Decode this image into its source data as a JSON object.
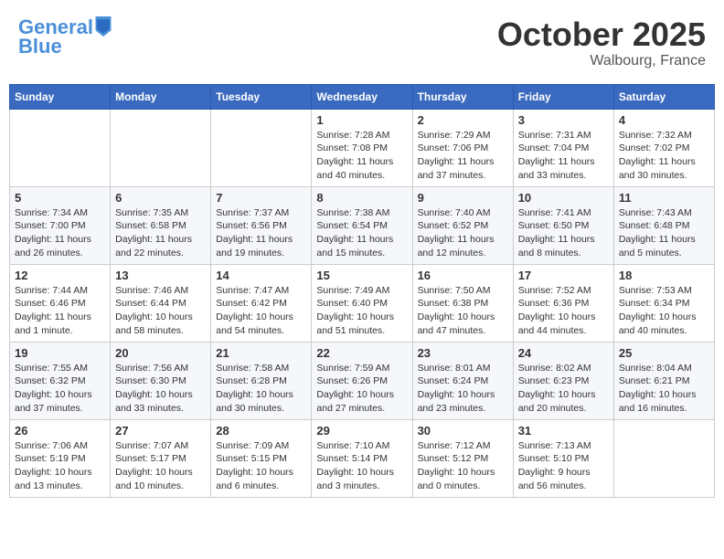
{
  "header": {
    "logo_line1": "General",
    "logo_line2": "Blue",
    "month": "October 2025",
    "location": "Walbourg, France"
  },
  "days_of_week": [
    "Sunday",
    "Monday",
    "Tuesday",
    "Wednesday",
    "Thursday",
    "Friday",
    "Saturday"
  ],
  "weeks": [
    [
      {
        "day": "",
        "info": ""
      },
      {
        "day": "",
        "info": ""
      },
      {
        "day": "",
        "info": ""
      },
      {
        "day": "1",
        "info": "Sunrise: 7:28 AM\nSunset: 7:08 PM\nDaylight: 11 hours and 40 minutes."
      },
      {
        "day": "2",
        "info": "Sunrise: 7:29 AM\nSunset: 7:06 PM\nDaylight: 11 hours and 37 minutes."
      },
      {
        "day": "3",
        "info": "Sunrise: 7:31 AM\nSunset: 7:04 PM\nDaylight: 11 hours and 33 minutes."
      },
      {
        "day": "4",
        "info": "Sunrise: 7:32 AM\nSunset: 7:02 PM\nDaylight: 11 hours and 30 minutes."
      }
    ],
    [
      {
        "day": "5",
        "info": "Sunrise: 7:34 AM\nSunset: 7:00 PM\nDaylight: 11 hours and 26 minutes."
      },
      {
        "day": "6",
        "info": "Sunrise: 7:35 AM\nSunset: 6:58 PM\nDaylight: 11 hours and 22 minutes."
      },
      {
        "day": "7",
        "info": "Sunrise: 7:37 AM\nSunset: 6:56 PM\nDaylight: 11 hours and 19 minutes."
      },
      {
        "day": "8",
        "info": "Sunrise: 7:38 AM\nSunset: 6:54 PM\nDaylight: 11 hours and 15 minutes."
      },
      {
        "day": "9",
        "info": "Sunrise: 7:40 AM\nSunset: 6:52 PM\nDaylight: 11 hours and 12 minutes."
      },
      {
        "day": "10",
        "info": "Sunrise: 7:41 AM\nSunset: 6:50 PM\nDaylight: 11 hours and 8 minutes."
      },
      {
        "day": "11",
        "info": "Sunrise: 7:43 AM\nSunset: 6:48 PM\nDaylight: 11 hours and 5 minutes."
      }
    ],
    [
      {
        "day": "12",
        "info": "Sunrise: 7:44 AM\nSunset: 6:46 PM\nDaylight: 11 hours and 1 minute."
      },
      {
        "day": "13",
        "info": "Sunrise: 7:46 AM\nSunset: 6:44 PM\nDaylight: 10 hours and 58 minutes."
      },
      {
        "day": "14",
        "info": "Sunrise: 7:47 AM\nSunset: 6:42 PM\nDaylight: 10 hours and 54 minutes."
      },
      {
        "day": "15",
        "info": "Sunrise: 7:49 AM\nSunset: 6:40 PM\nDaylight: 10 hours and 51 minutes."
      },
      {
        "day": "16",
        "info": "Sunrise: 7:50 AM\nSunset: 6:38 PM\nDaylight: 10 hours and 47 minutes."
      },
      {
        "day": "17",
        "info": "Sunrise: 7:52 AM\nSunset: 6:36 PM\nDaylight: 10 hours and 44 minutes."
      },
      {
        "day": "18",
        "info": "Sunrise: 7:53 AM\nSunset: 6:34 PM\nDaylight: 10 hours and 40 minutes."
      }
    ],
    [
      {
        "day": "19",
        "info": "Sunrise: 7:55 AM\nSunset: 6:32 PM\nDaylight: 10 hours and 37 minutes."
      },
      {
        "day": "20",
        "info": "Sunrise: 7:56 AM\nSunset: 6:30 PM\nDaylight: 10 hours and 33 minutes."
      },
      {
        "day": "21",
        "info": "Sunrise: 7:58 AM\nSunset: 6:28 PM\nDaylight: 10 hours and 30 minutes."
      },
      {
        "day": "22",
        "info": "Sunrise: 7:59 AM\nSunset: 6:26 PM\nDaylight: 10 hours and 27 minutes."
      },
      {
        "day": "23",
        "info": "Sunrise: 8:01 AM\nSunset: 6:24 PM\nDaylight: 10 hours and 23 minutes."
      },
      {
        "day": "24",
        "info": "Sunrise: 8:02 AM\nSunset: 6:23 PM\nDaylight: 10 hours and 20 minutes."
      },
      {
        "day": "25",
        "info": "Sunrise: 8:04 AM\nSunset: 6:21 PM\nDaylight: 10 hours and 16 minutes."
      }
    ],
    [
      {
        "day": "26",
        "info": "Sunrise: 7:06 AM\nSunset: 5:19 PM\nDaylight: 10 hours and 13 minutes."
      },
      {
        "day": "27",
        "info": "Sunrise: 7:07 AM\nSunset: 5:17 PM\nDaylight: 10 hours and 10 minutes."
      },
      {
        "day": "28",
        "info": "Sunrise: 7:09 AM\nSunset: 5:15 PM\nDaylight: 10 hours and 6 minutes."
      },
      {
        "day": "29",
        "info": "Sunrise: 7:10 AM\nSunset: 5:14 PM\nDaylight: 10 hours and 3 minutes."
      },
      {
        "day": "30",
        "info": "Sunrise: 7:12 AM\nSunset: 5:12 PM\nDaylight: 10 hours and 0 minutes."
      },
      {
        "day": "31",
        "info": "Sunrise: 7:13 AM\nSunset: 5:10 PM\nDaylight: 9 hours and 56 minutes."
      },
      {
        "day": "",
        "info": ""
      }
    ]
  ]
}
